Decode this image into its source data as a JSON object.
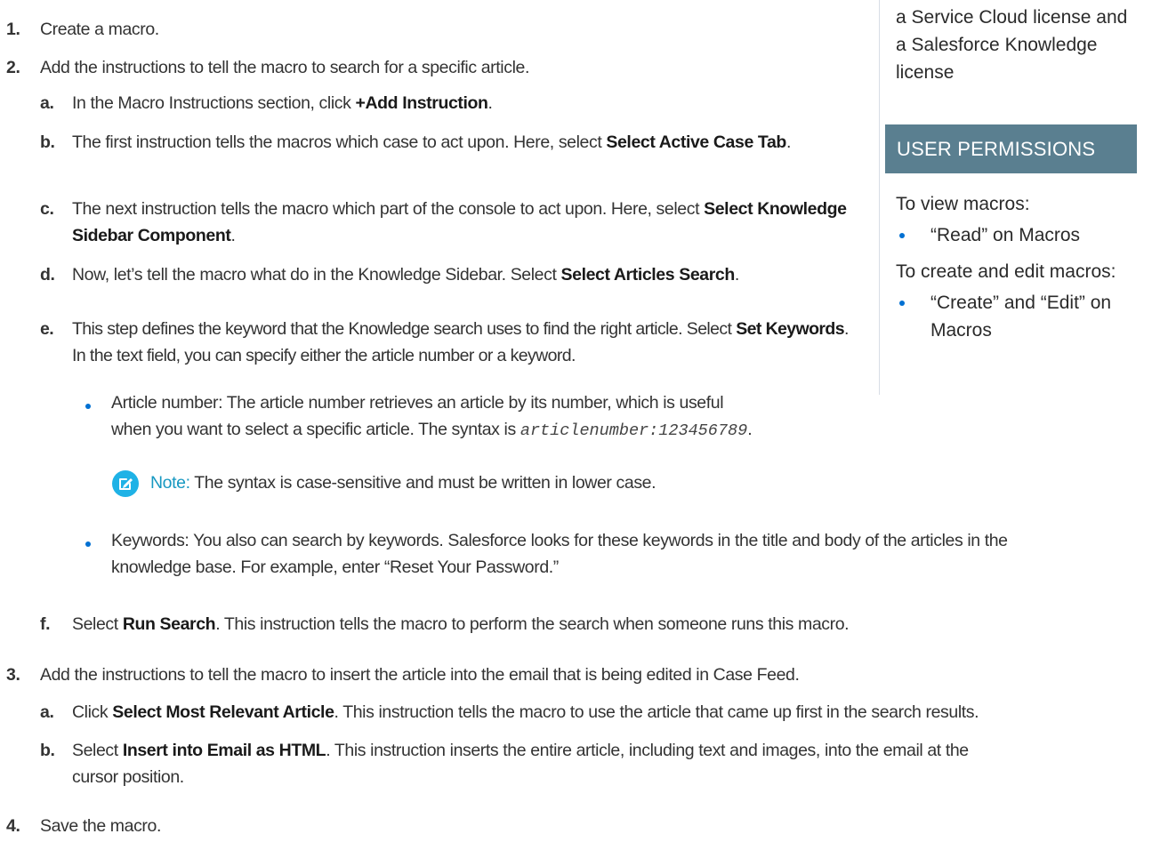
{
  "steps": {
    "s1": {
      "num": "1.",
      "text": "Create a macro."
    },
    "s2": {
      "num": "2.",
      "text": "Add the instructions to tell the macro to search for a specific article."
    },
    "a": {
      "num": "a.",
      "pre": "In the Macro Instructions section, click ",
      "bold": "+Add Instruction",
      "post": "."
    },
    "b": {
      "num": "b.",
      "pre": "The first instruction tells the macros which case to act upon. Here, select ",
      "bold": "Select Active Case Tab",
      "post": "."
    },
    "c": {
      "num": "c.",
      "pre": "The next instruction tells the macro which part of the console to act upon. Here, select ",
      "bold": "Select Knowledge Sidebar Component",
      "post": "."
    },
    "d": {
      "num": "d.",
      "pre": "Now, let’s tell the macro what do in the Knowledge Sidebar. Select ",
      "bold": "Select Articles Search",
      "post": "."
    },
    "e": {
      "num": "e.",
      "pre": "This step defines the keyword that the Knowledge search uses to find the right article. Select ",
      "bold": "Set Keywords",
      "post": ". In the text field, you can specify either the article number or a keyword."
    },
    "bullet1": {
      "line1": "Article number: The article number retrieves an article by its number, which is useful",
      "line2pre": "when you want to select a specific article. The syntax is ",
      "code": "articlenumber:123456789",
      "line2post": "."
    },
    "note": {
      "label": "Note:",
      "text": " The syntax is case-sensitive and must be written in lower case."
    },
    "bullet2": {
      "line1": "Keywords: You also can search by keywords. Salesforce looks for these keywords in the title and body of the articles in the",
      "line2": "knowledge base. For example, enter “Reset Your Password.”"
    },
    "f": {
      "num": "f.",
      "pre": "Select ",
      "bold": "Run Search",
      "post": ". This instruction tells the macro to perform the search when someone runs this macro."
    },
    "s3": {
      "num": "3.",
      "text": "Add the instructions to tell the macro to insert the article into the email that is being edited in Case Feed."
    },
    "a3": {
      "num": "a.",
      "pre": "Click ",
      "bold": "Select Most Relevant Article",
      "post": ". This instruction tells the macro to use the article that came up first in the search results."
    },
    "b3": {
      "num": "b.",
      "pre": "Select ",
      "bold": "Insert into Email as HTML",
      "post": ". This instruction inserts the entire article, including text and images, into the email at the",
      "line2": "cursor position."
    },
    "s4": {
      "num": "4.",
      "text": "Save the macro."
    }
  },
  "sidebar": {
    "license_lines": [
      "a Service Cloud license and",
      "a Salesforce Knowledge",
      "license"
    ],
    "heading": "USER PERMISSIONS",
    "view_label": "To view macros:",
    "view_item": "“Read” on Macros",
    "create_label": "To create and edit macros:",
    "create_item_line1": "“Create” and “Edit” on",
    "create_item_line2": "Macros"
  },
  "colors": {
    "accent": "#0070d2",
    "note_icon": "#1fb2e6",
    "sidebar_head": "#5a7f90"
  },
  "icons": {
    "note": "edit-note-icon"
  }
}
